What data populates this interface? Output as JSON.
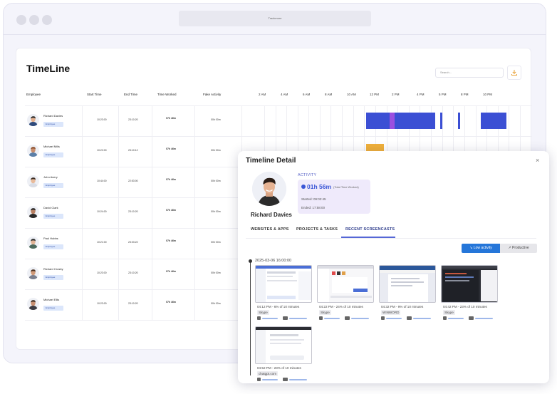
{
  "browser": {
    "url": "Trackmore"
  },
  "page": {
    "title": "TimeLine",
    "search_placeholder": "Search...",
    "columns": {
      "employee": "Employee",
      "start": "Start Time",
      "end": "End Time",
      "worked": "Time Worked",
      "fake": "Fake Activity"
    },
    "hours": [
      "2 AM",
      "4 AM",
      "6 AM",
      "8 AM",
      "10 AM",
      "12 PM",
      "2 PM",
      "4 PM",
      "5 PM",
      "8 PM",
      "10 PM"
    ],
    "rows": [
      {
        "name": "Richard Davies",
        "role": "Employee",
        "start": "10:23:00",
        "end": "23:10:20",
        "worked": "07h 46m",
        "fake": "00h 00m"
      },
      {
        "name": "Michael Mills",
        "role": "Employee",
        "start": "10:22:00",
        "end": "23:10:12",
        "worked": "07h 46m",
        "fake": "00h 00m"
      },
      {
        "name": "John Avery",
        "role": "Employee",
        "start": "10:44:00",
        "end": "22:53:00",
        "worked": "07h 46m",
        "fake": "00h 00m"
      },
      {
        "name": "David Clark",
        "role": "Employee",
        "start": "10:24:00",
        "end": "23:10:20",
        "worked": "07h 46m",
        "fake": "00h 00m"
      },
      {
        "name": "Paul Hobbs",
        "role": "Employee",
        "start": "10:21:00",
        "end": "23:03:22",
        "worked": "07h 46m",
        "fake": "00h 00m"
      },
      {
        "name": "Richard Crosby",
        "role": "Employee",
        "start": "10:23:00",
        "end": "23:10:20",
        "worked": "07h 46m",
        "fake": "00h 00m"
      },
      {
        "name": "Michael Ellis",
        "role": "Employee",
        "start": "10:23:00",
        "end": "23:10:20",
        "worked": "07h 46m",
        "fake": "00h 00m"
      }
    ]
  },
  "detail": {
    "title": "Timeline Detail",
    "close": "×",
    "person": "Richard Davies",
    "activity_label": "ACTIVITY",
    "total": "01h 56m",
    "total_note": "(Total Time Worked)",
    "started": "Started: 09:02:45",
    "ended": "Ended: 17:58:00",
    "tabs": [
      "WEBSITES & APPS",
      "PROJECTS & TASKS",
      "RECENT SCREENCASTS"
    ],
    "active_tab": "RECENT SCREENCASTS",
    "toggle": {
      "low": "Low activity",
      "productive": "Productive"
    },
    "date": "2025-03-06 16:00:00",
    "shots": [
      {
        "time": "04:12 PM - 6% of 10 minutes",
        "app": "Skype"
      },
      {
        "time": "04:22 PM - 24% of 10 minutes",
        "app": "Skype"
      },
      {
        "time": "04:32 PM - 9% of 10 minutes",
        "app": "WINWORD"
      },
      {
        "time": "04:42 PM - 23% of 10 minutes",
        "app": "Skype"
      },
      {
        "time": "04:52 PM - 23% of 10 minutes",
        "app": "chatgpt.com"
      }
    ]
  },
  "colors": {
    "accent": "#3a56d6",
    "bar_blue": "#3b4fd4",
    "bar_purple": "#9a4fe0",
    "bar_orange": "#f0b03a",
    "toggle_blue": "#2576d9"
  }
}
